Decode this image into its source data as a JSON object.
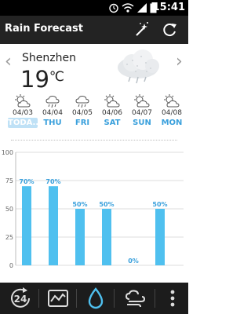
{
  "status_bar": {
    "time": "15:41"
  },
  "app_bar": {
    "title": "Rain Forecast"
  },
  "current": {
    "city": "Shenzhen",
    "temperature": "19",
    "unit": "℃",
    "condition_icon": "cloud-rain-icon"
  },
  "days": [
    {
      "date": "04/03",
      "label": "TODA..",
      "icon": "sun-cloud-icon",
      "selected": true
    },
    {
      "date": "04/04",
      "label": "THU",
      "icon": "rain-cloud-icon",
      "selected": false
    },
    {
      "date": "04/05",
      "label": "FRI",
      "icon": "rain-cloud-icon",
      "selected": false
    },
    {
      "date": "04/06",
      "label": "SAT",
      "icon": "sun-cloud-icon",
      "selected": false
    },
    {
      "date": "04/07",
      "label": "SUN",
      "icon": "sun-cloud-icon",
      "selected": false
    },
    {
      "date": "04/08",
      "label": "MON",
      "icon": "sun-cloud-icon",
      "selected": false
    }
  ],
  "chart_data": {
    "type": "bar",
    "categories": [
      "04/03",
      "04/04",
      "04/05",
      "04/06",
      "04/07",
      "04/08"
    ],
    "values": [
      70,
      70,
      50,
      50,
      0,
      50
    ],
    "value_labels": [
      "70%",
      "70%",
      "50%",
      "50%",
      "0%",
      "50%"
    ],
    "ylim": [
      0,
      100
    ],
    "yticks": [
      0,
      25,
      50,
      75,
      100
    ],
    "ytick_labels": [
      "0",
      "25",
      "50",
      "75",
      "100"
    ],
    "bar_color": "#4fc0ef",
    "label_color": "#3aa0dc",
    "grid": true
  },
  "bottom_nav": [
    {
      "name": "24-hour-tab",
      "icon": "24-hour-icon",
      "label": "24"
    },
    {
      "name": "trend-tab",
      "icon": "trend-chart-icon"
    },
    {
      "name": "rain-tab",
      "icon": "rain-drop-icon",
      "active": true
    },
    {
      "name": "wind-tab",
      "icon": "wind-cloud-icon"
    },
    {
      "name": "more-menu",
      "icon": "more-vertical-icon"
    }
  ],
  "colors": {
    "accent": "#3aa0dc",
    "bar": "#4fc0ef",
    "appbar": "#232323",
    "bottom_bar": "#1c1c1c"
  }
}
